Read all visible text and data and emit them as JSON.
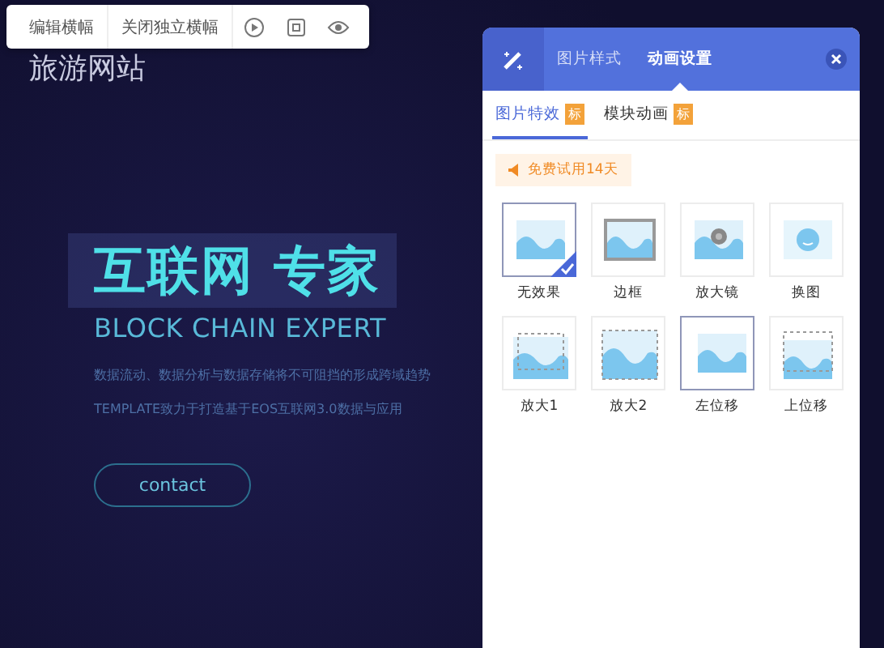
{
  "toolbar": {
    "buttons": [
      {
        "label": "编辑横幅",
        "kind": "text"
      },
      {
        "label": "关闭独立横幅",
        "kind": "text"
      },
      {
        "kind": "play"
      },
      {
        "kind": "frame"
      },
      {
        "kind": "eye"
      }
    ]
  },
  "site_title": "旅游网站",
  "hero": {
    "headline": "互联网 专家",
    "subtitle": "BLOCK CHAIN EXPERT",
    "lines": [
      "数据流动、数据分析与数据存储将不可阻挡的形成跨域趋势",
      "TEMPLATE致力于打造基于EOS互联网3.0数据与应用"
    ],
    "button": "contact"
  },
  "panel": {
    "tabs": [
      {
        "label": "图片样式",
        "selected": false
      },
      {
        "label": "动画设置",
        "selected": true
      }
    ],
    "subtabs": [
      {
        "label": "图片特效",
        "badge": "标",
        "selected": true
      },
      {
        "label": "模块动画",
        "badge": "标",
        "selected": false
      }
    ],
    "trial": "免费试用14天",
    "effects": [
      {
        "label": "无效果",
        "kind": "plain",
        "selected": true,
        "focused": false
      },
      {
        "label": "边框",
        "kind": "border",
        "selected": false,
        "focused": false
      },
      {
        "label": "放大镜",
        "kind": "magnifier",
        "selected": false,
        "focused": false
      },
      {
        "label": "换图",
        "kind": "swap",
        "selected": false,
        "focused": false
      },
      {
        "label": "放大1",
        "kind": "zoom1",
        "selected": false,
        "focused": false
      },
      {
        "label": "放大2",
        "kind": "zoom2",
        "selected": false,
        "focused": false
      },
      {
        "label": "左位移",
        "kind": "shift-left",
        "selected": false,
        "focused": true
      },
      {
        "label": "上位移",
        "kind": "shift-up",
        "selected": false,
        "focused": false
      }
    ]
  }
}
